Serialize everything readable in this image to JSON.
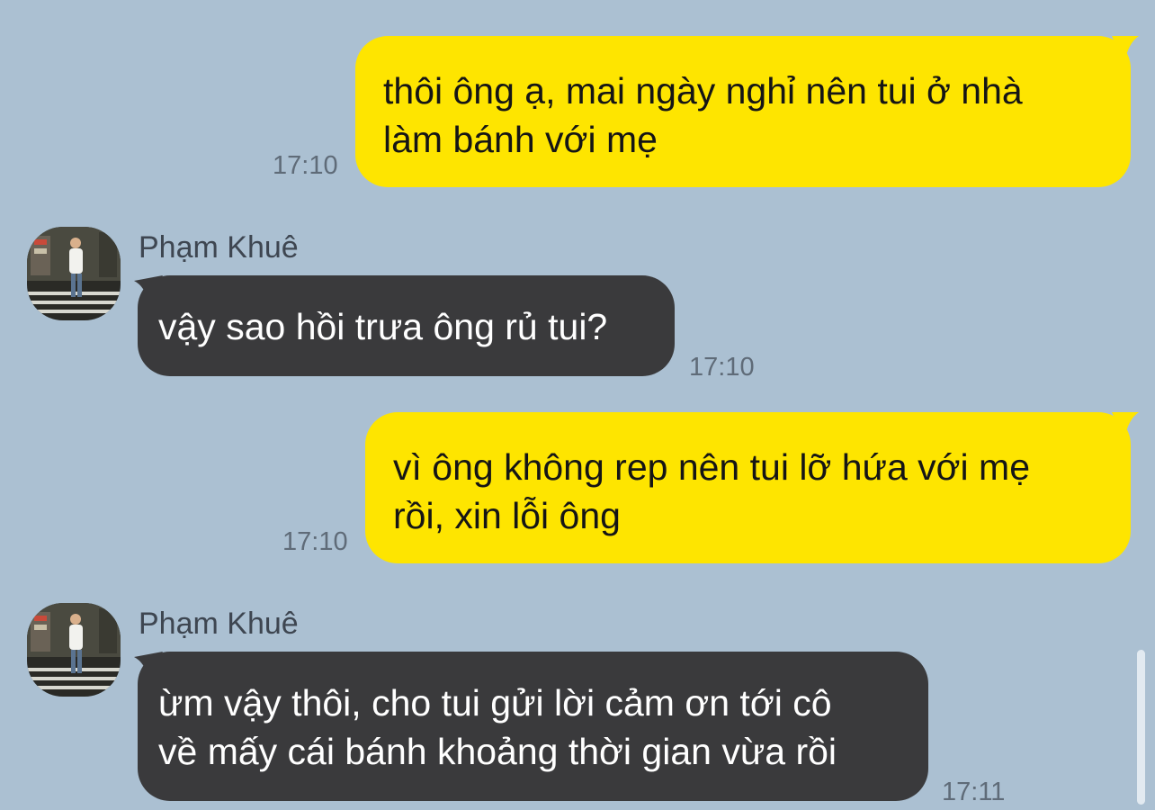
{
  "messages": [
    {
      "direction": "outgoing",
      "lines": [
        "thôi ông ạ, mai ngày nghỉ nên tui ở nhà",
        "làm bánh với mẹ"
      ],
      "time": "17:10"
    },
    {
      "direction": "incoming",
      "sender": "Phạm Khuê",
      "lines": [
        "vậy sao hồi trưa ông rủ tui?"
      ],
      "time": "17:10"
    },
    {
      "direction": "outgoing",
      "lines": [
        "vì ông không rep nên tui lỡ hứa với mẹ",
        "rồi, xin lỗi ông"
      ],
      "time": "17:10"
    },
    {
      "direction": "incoming",
      "sender": "Phạm Khuê",
      "lines": [
        "ừm vậy thôi, cho tui gửi lời cảm ơn tới cô",
        "về mấy cái bánh khoảng thời gian vừa rồi"
      ],
      "time": "17:11"
    }
  ],
  "colors": {
    "background": "#abc0d2",
    "outgoing_bubble": "#fee500",
    "incoming_bubble": "#3a3a3c",
    "timestamp": "#5f6b78"
  },
  "icons": {
    "avatar": "profile-photo-person-standing-street"
  }
}
